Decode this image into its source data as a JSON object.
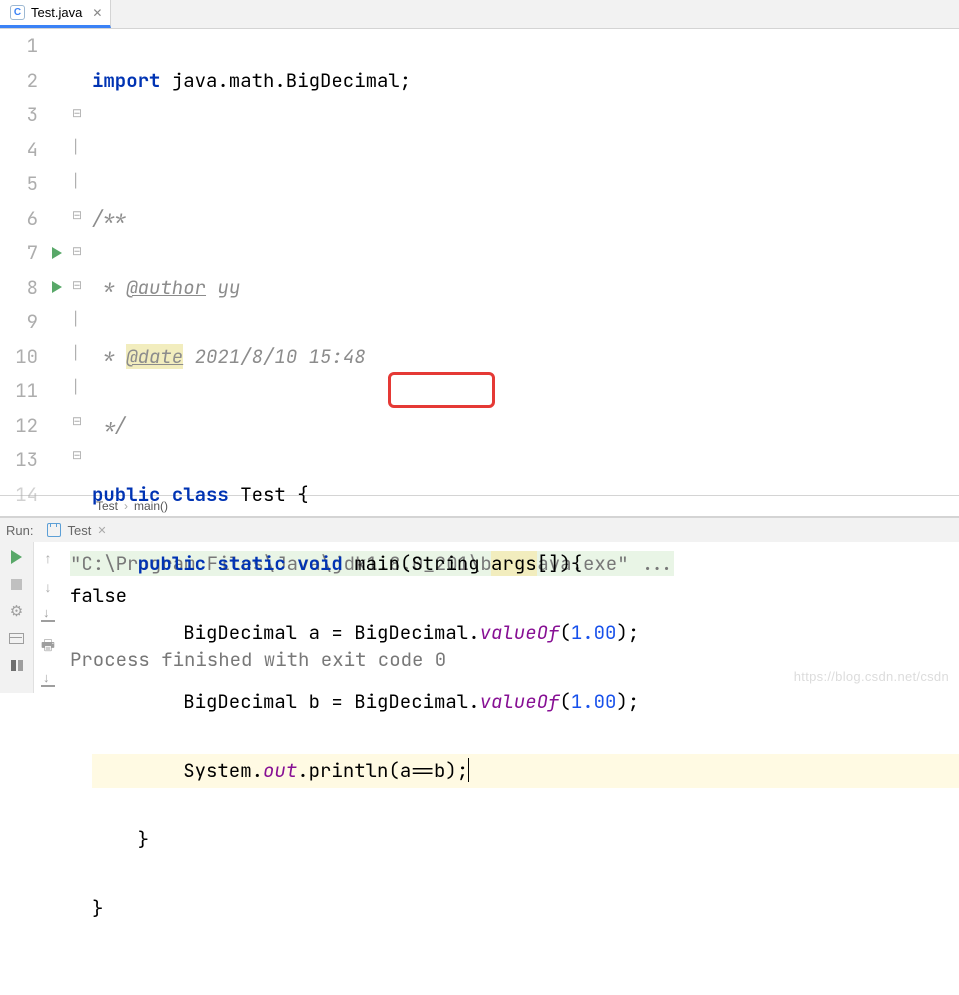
{
  "tab": {
    "filename": "Test.java"
  },
  "gutter": {
    "numbers": [
      "1",
      "2",
      "3",
      "4",
      "5",
      "6",
      "7",
      "8",
      "9",
      "10",
      "11",
      "12",
      "13",
      "14"
    ]
  },
  "annotation": {
    "highlight_target": "a==b in System.out.println(a==b);",
    "highlighted_line": 11
  },
  "code": {
    "l1": {
      "kw": "import",
      "rest": " java.math.BigDecimal;"
    },
    "l3": "/**",
    "l4": {
      "pre": " * ",
      "tag": "@author",
      "rest": " yy"
    },
    "l5": {
      "pre": " * ",
      "tag": "@date",
      "rest": " 2021/8/10 15:48"
    },
    "l6": " */",
    "l7": {
      "k1": "public",
      "k2": "class",
      "name": " Test {"
    },
    "l8": {
      "k1": "public",
      "k2": "static",
      "k3": "void",
      "m": " main(String ",
      "p": "args",
      "after": "[]){"
    },
    "l9": {
      "pre": "        BigDecimal a = BigDecimal.",
      "fn": "valueOf",
      "open": "(",
      "num": "1.00",
      "close": ");"
    },
    "l10": {
      "pre": "        BigDecimal b = BigDecimal.",
      "fn": "valueOf",
      "open": "(",
      "num": "1.00",
      "close": ");"
    },
    "l11": {
      "pre": "        System.",
      "out": "out",
      "mid": ".println(a==b);"
    },
    "l12": "    }",
    "l13": "}"
  },
  "breadcrumb": {
    "a": "Test",
    "b": "main()"
  },
  "run": {
    "panel_label": "Run:",
    "tab": "Test",
    "cmd": "\"C:\\Program Files\\Java\\jdk1.8.0_201\\bin\\java.exe\" ...",
    "out": "false",
    "exit": "Process finished with exit code 0"
  },
  "watermark": "https://blog.csdn.net/csdn"
}
